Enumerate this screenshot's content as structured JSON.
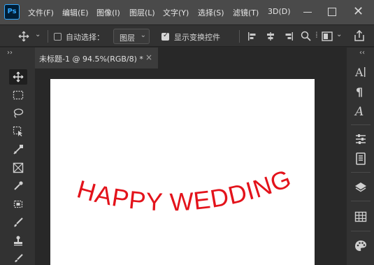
{
  "app": {
    "logo": "Ps"
  },
  "menu": {
    "items": [
      "文件(F)",
      "编辑(E)",
      "图像(I)",
      "图层(L)",
      "文字(Y)",
      "选择(S)",
      "滤镜(T)",
      "3D(D)"
    ]
  },
  "window_controls": {
    "minimize": "minimize-icon",
    "maximize": "maximize-icon",
    "close": "close-icon"
  },
  "options_bar": {
    "auto_select_label": "自动选择：",
    "auto_select_checked": false,
    "auto_select_target": "图层",
    "show_transform_label": "显示变换控件",
    "show_transform_checked": true
  },
  "document": {
    "tab_title": "未标题-1 @ 94.5%(RGB/8) *",
    "close_glyph": "×"
  },
  "panels": {
    "collapse_left": "››",
    "collapse_right": "‹‹"
  },
  "canvas": {
    "text": "HAPPY WEDDING",
    "text_color": "#e3131b",
    "warp": "arc"
  },
  "colors": {
    "menubar": "#4a4a4a",
    "panel": "#323232",
    "workspace": "#282828",
    "accent": "#31a8ff"
  }
}
